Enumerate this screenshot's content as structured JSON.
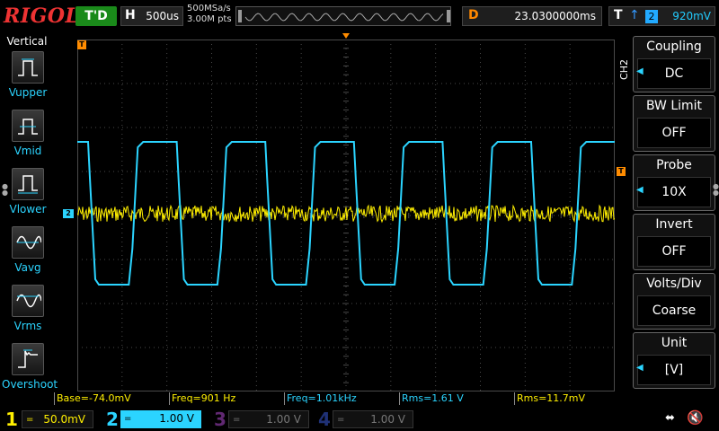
{
  "topbar": {
    "brand": "RIGOL",
    "trigger_status": "T'D",
    "horizontal": {
      "label": "H",
      "value": "500us"
    },
    "sample_rate": "500MSa/s",
    "memory_depth": "3.00M pts",
    "delay": {
      "label": "D",
      "value": "23.0300000ms"
    },
    "trigger": {
      "label": "T",
      "edge_icon": "rising-edge-icon",
      "source": "2",
      "level": "920mV"
    }
  },
  "left_panel": {
    "title": "Vertical",
    "items": [
      {
        "label": "Vupper",
        "icon": "vupper-icon"
      },
      {
        "label": "Vmid",
        "icon": "vmid-icon"
      },
      {
        "label": "Vlower",
        "icon": "vlower-icon"
      },
      {
        "label": "Vavg",
        "icon": "vavg-icon"
      },
      {
        "label": "Vrms",
        "icon": "vrms-icon"
      },
      {
        "label": "Overshoot",
        "icon": "overshoot-icon"
      }
    ]
  },
  "markers": {
    "trigger_pos": "T",
    "ch2": "2",
    "trigger_level": "T"
  },
  "right_menu": {
    "channel_tag": "CH2",
    "items": [
      {
        "title": "Coupling",
        "value": "DC",
        "has_arrow": true
      },
      {
        "title": "BW Limit",
        "value": "OFF",
        "has_arrow": false
      },
      {
        "title": "Probe",
        "value": "10X",
        "has_arrow": true
      },
      {
        "title": "Invert",
        "value": "OFF",
        "has_arrow": false
      },
      {
        "title": "Volts/Div",
        "value": "Coarse",
        "has_arrow": false
      },
      {
        "title": "Unit",
        "value": "[V]",
        "has_arrow": true
      }
    ]
  },
  "measurements": [
    {
      "text": "Base=-74.0mV",
      "color": "#ffef00"
    },
    {
      "text": "Freq=901 Hz",
      "color": "#ffef00"
    },
    {
      "text": "Freq=1.01kHz",
      "color": "#2bd4ff"
    },
    {
      "text": "Rms=1.61 V",
      "color": "#2bd4ff"
    },
    {
      "text": "Rms=11.7mV",
      "color": "#ffef00"
    }
  ],
  "channels": [
    {
      "num": "1",
      "coupling": "=",
      "scale": "50.0mV",
      "color": "#ffef00",
      "active": false,
      "enabled": true
    },
    {
      "num": "2",
      "coupling": "=",
      "scale": "1.00 V",
      "color": "#2bd4ff",
      "active": true,
      "enabled": true
    },
    {
      "num": "3",
      "coupling": "=",
      "scale": "1.00 V",
      "color": "#b04ad0",
      "active": false,
      "enabled": false
    },
    {
      "num": "4",
      "coupling": "=",
      "scale": "1.00 V",
      "color": "#3a5ad8",
      "active": false,
      "enabled": false
    }
  ],
  "status_icons": [
    "usb-icon",
    "speaker-muted-icon"
  ],
  "colors": {
    "ch1": "#ffef00",
    "ch2": "#2bd4ff",
    "trigger_marker": "#ff8c00",
    "grid": "#4a4a4a"
  }
}
